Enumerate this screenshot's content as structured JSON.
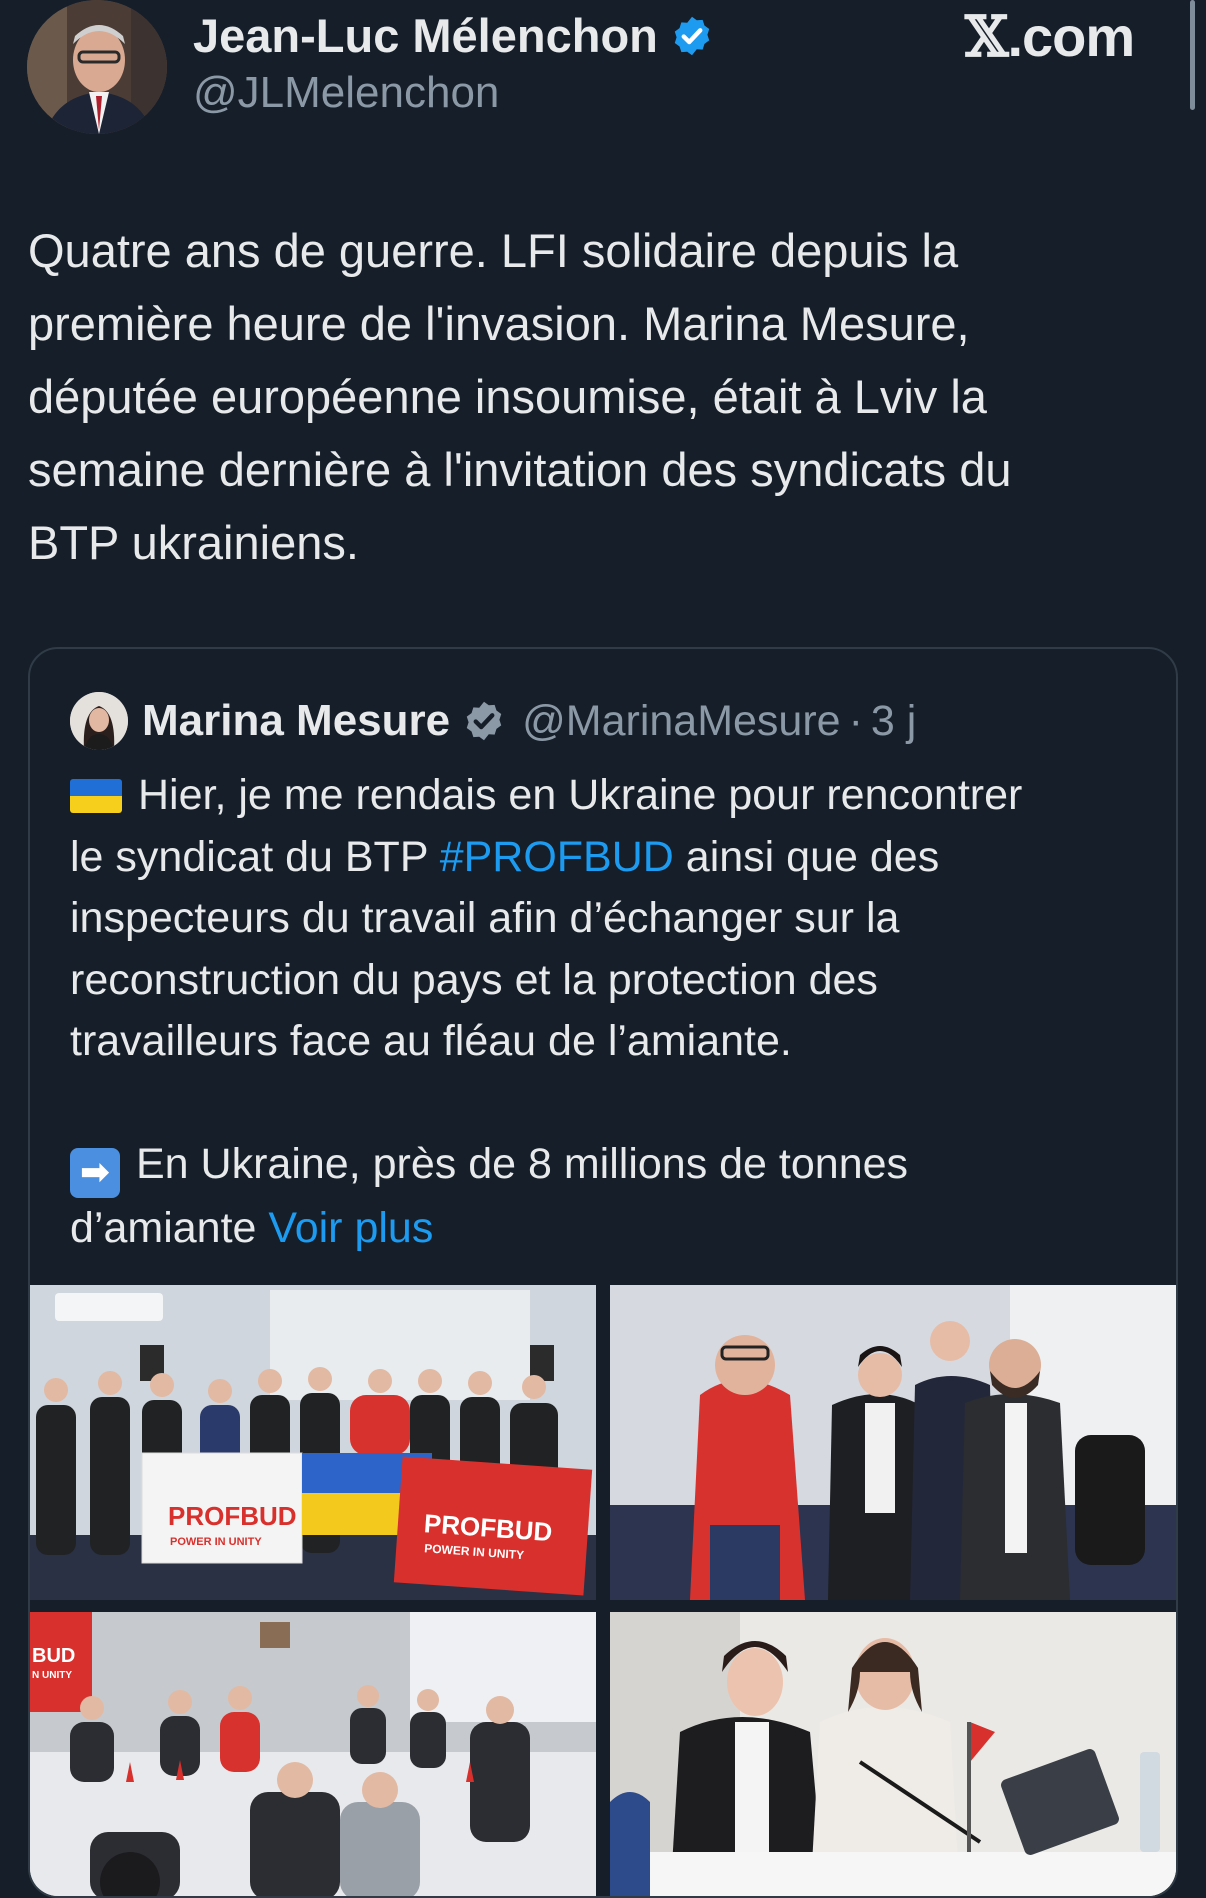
{
  "header": {
    "name": "Jean-Luc Mélenchon",
    "handle": "@JLMelenchon",
    "brand_x": "𝕏",
    "brand_rest": ".com"
  },
  "tweet": {
    "lines": [
      "Quatre ans de guerre. LFI solidaire depuis la",
      "première heure de l'invasion. Marina Mesure,",
      "députée européenne insoumise, était à Lviv la",
      "semaine dernière à l'invitation des syndicats du",
      "BTP ukrainiens."
    ]
  },
  "quote": {
    "name": "Marina Mesure",
    "handle": "@MarinaMesure",
    "dot": "·",
    "time": "3 j",
    "line1": "Hier, je me rendais en Ukraine pour rencontrer",
    "line2_before": "le syndicat du BTP ",
    "hashtag": "#PROFBUD",
    "line2_after": " ainsi que des",
    "line3": "inspecteurs du travail afin d’échanger sur la",
    "line4": "reconstruction du pays et la protection des",
    "line5": "travailleurs face au fléau de l’amiante.",
    "arrow_glyph": "➡",
    "line6": "En Ukraine, près de 8 millions de tonnes",
    "line7_before": "d’amiante ",
    "more": "Voir plus"
  },
  "photos": {
    "banner_main": "PROFBUD",
    "banner_sub": "POWER IN UNITY",
    "banner_partial": "BUD",
    "banner_partial_sub": "N UNITY"
  },
  "colors": {
    "background": "#151e29",
    "text": "#e7e9ea",
    "secondary": "#8b98a5",
    "link": "#1d9bf0",
    "verified": "#1d9bf0",
    "quote_verified": "#8b98a5"
  }
}
